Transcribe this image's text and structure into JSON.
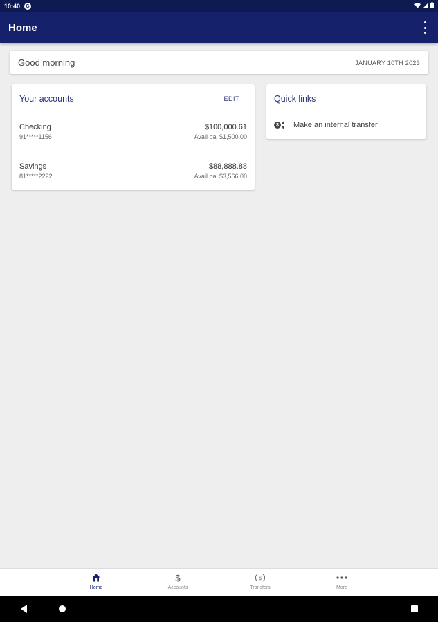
{
  "status_bar": {
    "time": "10:40"
  },
  "app_bar": {
    "title": "Home"
  },
  "greeting": {
    "message": "Good morning",
    "date": "JANUARY 10TH 2023"
  },
  "accounts_card": {
    "title": "Your accounts",
    "edit_label": "EDIT",
    "accounts": [
      {
        "name": "Checking",
        "number": "91*****1156",
        "balance": "$100,000.61",
        "available": "Avail bal $1,500.00"
      },
      {
        "name": "Savings",
        "number": "81*****2222",
        "balance": "$88,888.88",
        "available": "Avail bal $3,566.00"
      }
    ]
  },
  "quick_links": {
    "title": "Quick links",
    "items": [
      {
        "label": "Make an internal transfer",
        "icon": "transfer-icon"
      }
    ]
  },
  "bottom_nav": {
    "items": [
      {
        "label": "Home",
        "icon": "home-icon",
        "active": true
      },
      {
        "label": "Accounts",
        "icon": "dollar-icon",
        "active": false
      },
      {
        "label": "Transfers",
        "icon": "transfers-icon",
        "active": false
      },
      {
        "label": "More",
        "icon": "more-icon",
        "active": false
      }
    ]
  },
  "colors": {
    "app_bar": "#15216b",
    "status_bar": "#0e1a52",
    "accent_text": "#2a3275",
    "background": "#eeeeee"
  }
}
